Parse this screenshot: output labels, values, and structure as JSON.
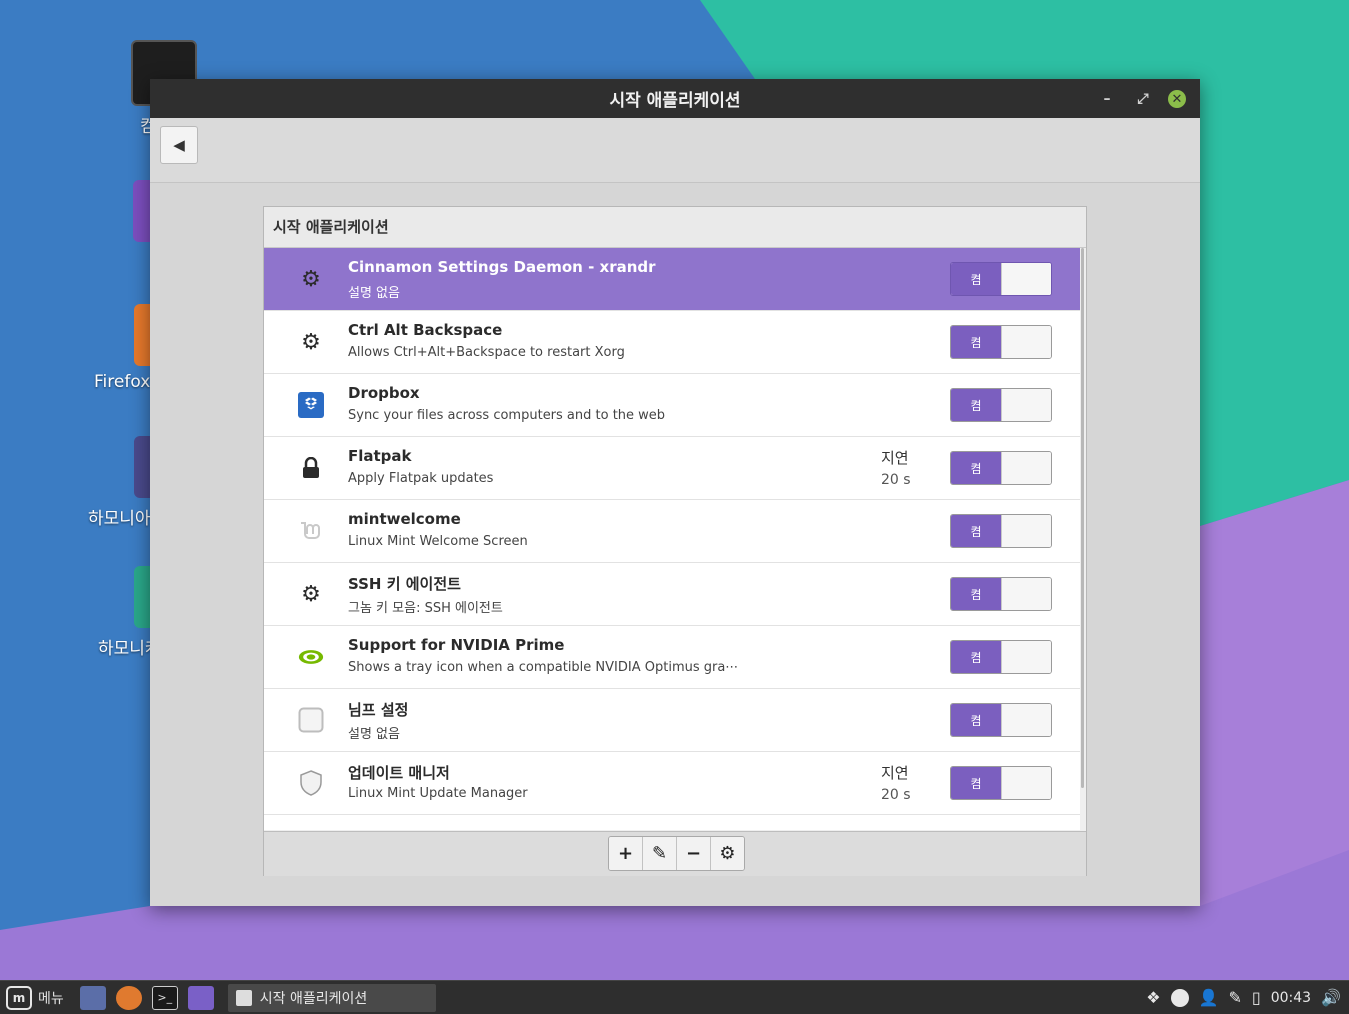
{
  "desktop": {
    "icons": [
      {
        "label": "컴"
      },
      {
        "label": ""
      },
      {
        "label": "Firefox"
      },
      {
        "label": "하모니아"
      },
      {
        "label": "하모니캐"
      }
    ]
  },
  "window": {
    "title": "시작 애플리케이션",
    "controls": {
      "minimize": "–",
      "maximize": "⤢",
      "close": "✕"
    },
    "back_icon": "back-arrow-icon"
  },
  "panel": {
    "header": "시작 애플리케이션",
    "toggle_on_label": "켬",
    "rows": [
      {
        "name": "Cinnamon Settings Daemon - xrandr",
        "desc": "설명 없음",
        "icon": "gear-icon",
        "delay_label": "",
        "delay_value": "",
        "enabled": true,
        "selected": true
      },
      {
        "name": "Ctrl Alt Backspace",
        "desc": "Allows Ctrl+Alt+Backspace to restart Xorg",
        "icon": "gear-icon",
        "delay_label": "",
        "delay_value": "",
        "enabled": true
      },
      {
        "name": "Dropbox",
        "desc": "Sync your files across computers and to the web",
        "icon": "dropbox-icon",
        "delay_label": "",
        "delay_value": "",
        "enabled": true
      },
      {
        "name": "Flatpak",
        "desc": "Apply Flatpak updates",
        "icon": "lock-icon",
        "delay_label": "지연",
        "delay_value": "20 s",
        "enabled": true
      },
      {
        "name": "mintwelcome",
        "desc": "Linux Mint Welcome Screen",
        "icon": "mint-logo-icon",
        "delay_label": "",
        "delay_value": "",
        "enabled": true
      },
      {
        "name": "SSH 키 에이전트",
        "desc": "그놈 키 모음: SSH 에이전트",
        "icon": "gear-icon",
        "delay_label": "",
        "delay_value": "",
        "enabled": true
      },
      {
        "name": "Support for NVIDIA Prime",
        "desc": "Shows a tray icon when a compatible NVIDIA Optimus gra⋯",
        "icon": "nvidia-icon",
        "delay_label": "",
        "delay_value": "",
        "enabled": true
      },
      {
        "name": "님프 설정",
        "desc": "설명 없음",
        "icon": "blank-app-icon",
        "delay_label": "",
        "delay_value": "",
        "enabled": true
      },
      {
        "name": "업데이트 매니저",
        "desc": "Linux Mint Update Manager",
        "icon": "shield-icon",
        "delay_label": "지연",
        "delay_value": "20 s",
        "enabled": true
      }
    ],
    "bottom_buttons": [
      {
        "label": "+",
        "icon": "add-icon"
      },
      {
        "label": "✎",
        "icon": "edit-icon"
      },
      {
        "label": "−",
        "icon": "remove-icon"
      },
      {
        "label": "⚙",
        "icon": "run-now-icon"
      }
    ]
  },
  "taskbar": {
    "menu_label": "메뉴",
    "task_title": "시작 애플리케이션",
    "clock": "00:43"
  },
  "colors": {
    "selection": "#8f74cc",
    "toggle_on": "#7b5fbf",
    "titlebar": "#2f2f2f",
    "close_button": "#8bbd4a"
  }
}
